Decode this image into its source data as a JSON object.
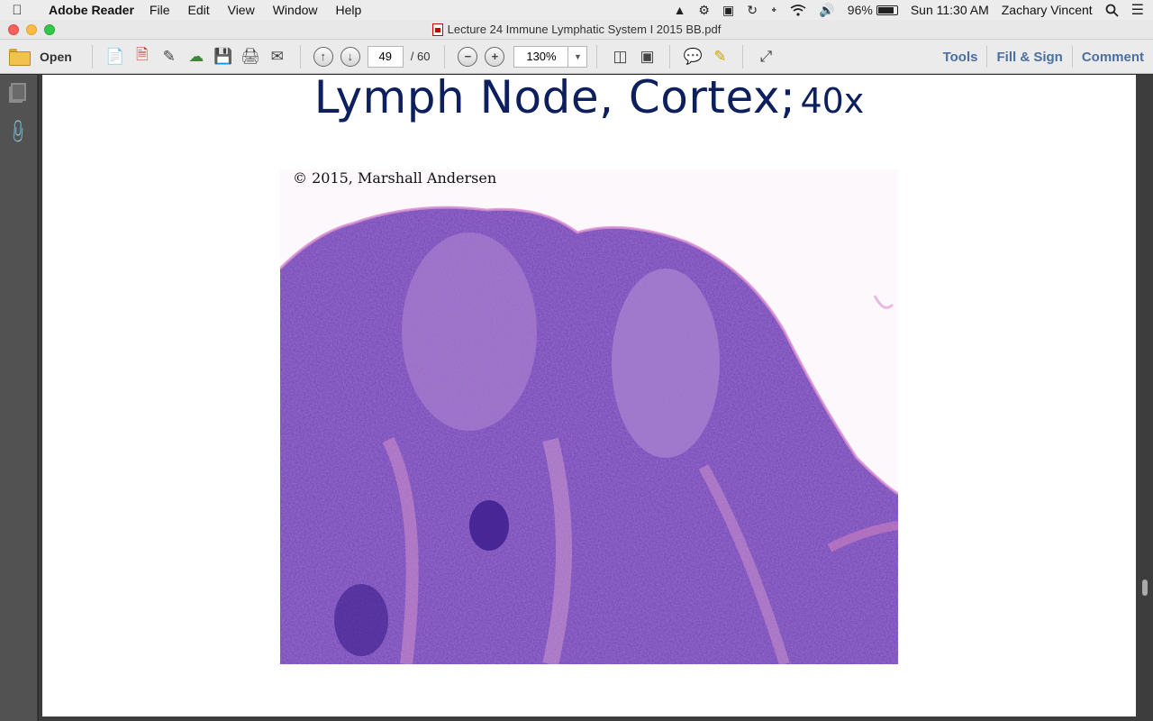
{
  "menubar": {
    "app_name": "Adobe Reader",
    "menus": [
      "File",
      "Edit",
      "View",
      "Window",
      "Help"
    ],
    "battery": "96%",
    "clock": "Sun 11:30 AM",
    "user": "Zachary Vincent"
  },
  "window": {
    "title": "Lecture 24 Immune Lymphatic System I 2015 BB.pdf"
  },
  "toolbar": {
    "open_label": "Open",
    "page_current": "49",
    "page_total": "/ 60",
    "zoom": "130%",
    "tools_label": "Tools",
    "fill_sign_label": "Fill & Sign",
    "comment_label": "Comment"
  },
  "slide": {
    "title": "Lymph Node, Cortex;",
    "magnification": "40x",
    "copyright": "© 2015, Marshall Andersen"
  },
  "colors": {
    "title_blue": "#0d1f5c",
    "stain_purple": "#5a2aa8",
    "stain_pink": "#d48ad0",
    "tab_blue": "#4a6fa0"
  }
}
